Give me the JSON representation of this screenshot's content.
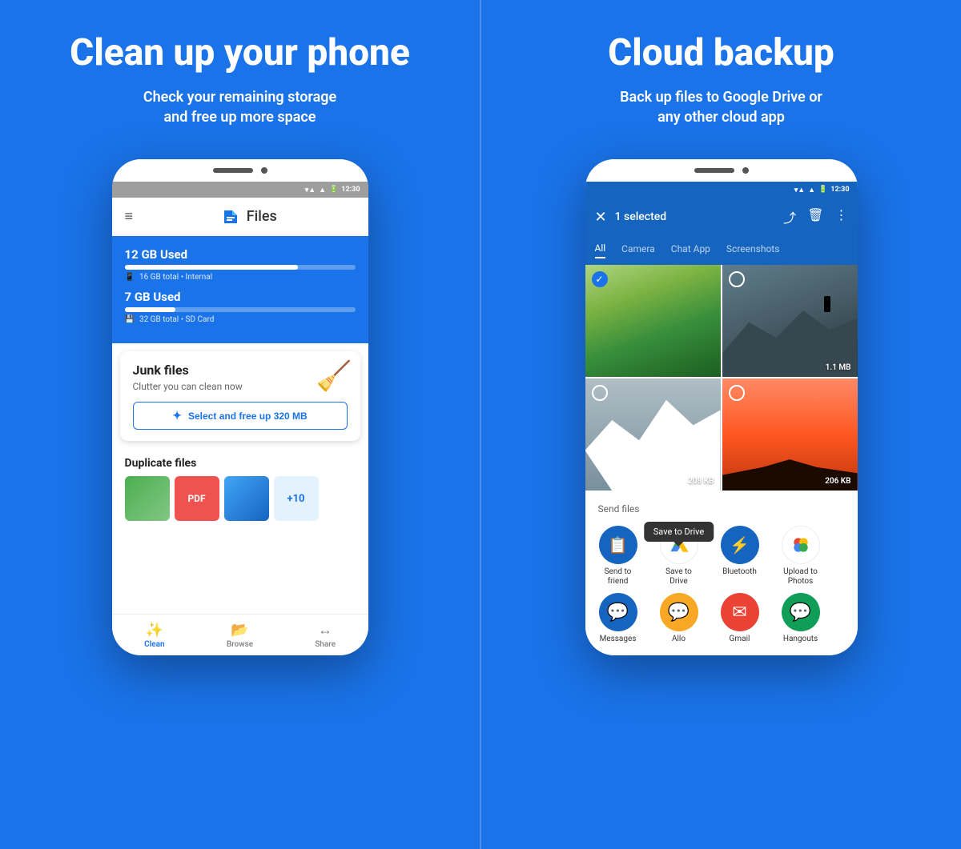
{
  "left_panel": {
    "title": "Clean up your phone",
    "subtitle": "Check your remaining storage\nand free up more space",
    "app_name": "Files",
    "time": "12:30",
    "storage": {
      "internal": {
        "label": "12 GB Used",
        "detail": "16 GB total • Internal",
        "fill_pct": 75
      },
      "sd": {
        "label": "7 GB Used",
        "detail": "32 GB total • SD Card",
        "fill_pct": 22
      }
    },
    "junk": {
      "title": "Junk files",
      "subtitle": "Clutter you can clean now",
      "cta": "Select and free up 320 MB"
    },
    "duplicate": {
      "title": "Duplicate files",
      "more_label": "+10"
    },
    "nav": {
      "clean_label": "Clean",
      "browse_label": "Browse",
      "share_label": "Share"
    }
  },
  "right_panel": {
    "title": "Cloud backup",
    "subtitle": "Back up files to Google Drive or\nany other cloud app",
    "time": "12:30",
    "toolbar": {
      "selected_label": "1 selected"
    },
    "tabs": [
      "All",
      "Camera",
      "Chat App",
      "Screenshots"
    ],
    "photos": [
      {
        "size": null,
        "checked": true
      },
      {
        "size": "1.1 MB",
        "checked": false
      },
      {
        "size": "208 KB",
        "checked": false
      },
      {
        "size": "206 KB",
        "checked": false
      }
    ],
    "send_files_label": "Send files",
    "apps_row1": [
      {
        "label": "Send to\nfriend",
        "color": "#1565C0",
        "icon": "📋"
      },
      {
        "label": "Save to Drive",
        "color": "#34A853",
        "icon": "drive",
        "tooltip": "Save to Drive"
      },
      {
        "label": "Bluetooth",
        "color": "#1565C0",
        "icon": "bluetooth"
      },
      {
        "label": "Upload to\nPhotos",
        "color": "#EA4335",
        "icon": "pinwheel"
      }
    ],
    "apps_row2": [
      {
        "label": "Messages",
        "color": "#1565C0",
        "icon": "💬"
      },
      {
        "label": "Allo",
        "color": "#F9A825",
        "icon": "💬"
      },
      {
        "label": "Gmail",
        "color": "#EA4335",
        "icon": "✉"
      },
      {
        "label": "Hangouts",
        "color": "#0F9D58",
        "icon": "💬"
      }
    ]
  }
}
